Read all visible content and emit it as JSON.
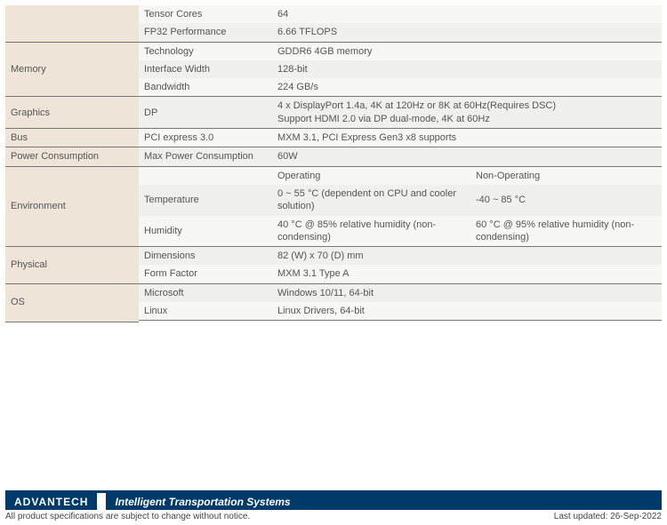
{
  "rows": {
    "tensor_label": "Tensor Cores",
    "tensor_val": "64",
    "fp32_label": "FP32 Performance",
    "fp32_val": "6.66 TFLOPS",
    "memory_cat": "Memory",
    "mem_tech_label": "Technology",
    "mem_tech_val": "GDDR6 4GB memory",
    "mem_iw_label": "Interface Width",
    "mem_iw_val": "128-bit",
    "mem_bw_label": "Bandwidth",
    "mem_bw_val": "224 GB/s",
    "graphics_cat": "Graphics",
    "dp_label": "DP",
    "dp_val": "4 x DisplayPort 1.4a, 4K at 120Hz or 8K at 60Hz(Requires DSC)\nSupport HDMI 2.0 via DP dual-mode, 4K at 60Hz",
    "bus_cat": "Bus",
    "bus_label": "PCI express 3.0",
    "bus_val": "MXM 3.1, PCI Express Gen3 x8 supports",
    "pc_cat": "Power Consumption",
    "pc_label": "Max Power Consumption",
    "pc_val": "60W",
    "env_cat": "Environment",
    "env_op": "Operating",
    "env_nop": "Non-Operating",
    "env_temp_label": "Temperature",
    "env_temp_op": "0 ~ 55 °C (dependent on CPU and cooler solution)",
    "env_temp_nop": "-40 ~ 85 °C",
    "env_hum_label": "Humidity",
    "env_hum_op": "40 °C @ 85% relative humidity (non-condensing)",
    "env_hum_nop": "60 °C @ 95% relative humidity (non-condensing)",
    "phys_cat": "Physical",
    "phys_dim_label": "Dimensions",
    "phys_dim_val": "82 (W) x 70 (D) mm",
    "phys_ff_label": "Form Factor",
    "phys_ff_val": "MXM 3.1 Type A",
    "os_cat": "OS",
    "os_ms_label": "Microsoft",
    "os_ms_val": "Windows 10/11, 64-bit",
    "os_lin_label": "Linux",
    "os_lin_val": "Linux Drivers, 64-bit"
  },
  "footer": {
    "brand": "ADVANTECH",
    "bar_title": "Intelligent Transportation Systems",
    "notice": "All product specifications are subject to change without notice.",
    "updated": "Last updated: 26-Sep-2022"
  }
}
